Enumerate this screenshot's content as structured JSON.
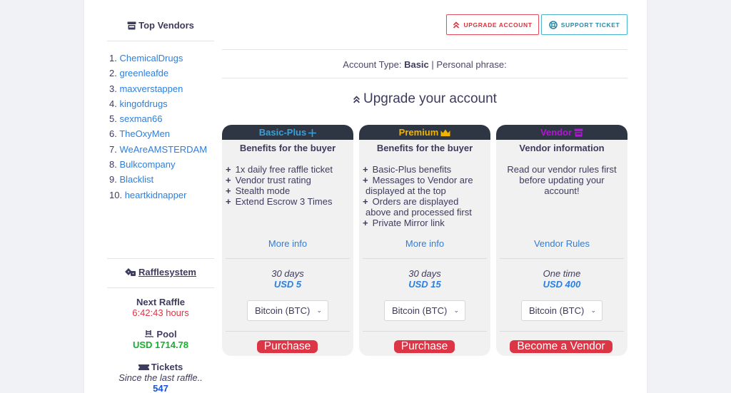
{
  "colors": {
    "link": "#2a7fe0",
    "danger": "#dc3545",
    "success": "#16b02c",
    "card_header": "#2e3644",
    "basic_plus": "#3aa0d8",
    "premium": "#f0b400",
    "vendor": "#b316d6"
  },
  "sidebar": {
    "top_vendors_title": "Top Vendors",
    "top_vendors_icon": "store-icon",
    "vendors": [
      {
        "rank": "1.",
        "name": "ChemicalDrugs"
      },
      {
        "rank": "2.",
        "name": "greenleafde"
      },
      {
        "rank": "3.",
        "name": "maxverstappen"
      },
      {
        "rank": "4.",
        "name": "kingofdrugs"
      },
      {
        "rank": "5.",
        "name": "sexman66"
      },
      {
        "rank": "6.",
        "name": "TheOxyMen"
      },
      {
        "rank": "7.",
        "name": "WeAreAMSTERDAM"
      },
      {
        "rank": "8.",
        "name": "Bulkcompany"
      },
      {
        "rank": "9.",
        "name": "Blacklist"
      },
      {
        "rank": "10.",
        "name": "heartkidnapper"
      }
    ],
    "raffle": {
      "title": "Rafflesystem",
      "title_icon": "dice-icon",
      "next_label": "Next Raffle",
      "next_value": "6:42:43 hours",
      "pool_label": "Pool",
      "pool_icon": "swimming-pool-icon",
      "pool_value": "USD 1714.78",
      "tickets_label": "Tickets",
      "tickets_icon": "ticket-icon",
      "tickets_note": "Since the last raffle..",
      "tickets_value": "547"
    }
  },
  "header": {
    "upgrade_button": "UPGRADE ACCOUNT",
    "support_button": "SUPPORT TICKET"
  },
  "account": {
    "type_label": "Account Type:",
    "type_value": "Basic",
    "separator": "|",
    "phrase_label": "Personal phrase:"
  },
  "upgrade_title": "Upgrade your account",
  "cards": [
    {
      "title": "Basic-Plus",
      "icon": "plus-icon",
      "subtitle": "Benefits for the buyer",
      "benefits": [
        [
          "1x daily free raffle ticket"
        ],
        [
          "Vendor trust rating"
        ],
        [
          "Stealth mode"
        ],
        [
          "Extend Escrow 3 Times"
        ]
      ],
      "link": "More info",
      "duration": "30 days",
      "price": "USD 5",
      "payment_selected": "Bitcoin (BTC)",
      "button": "Purchase"
    },
    {
      "title": "Premium",
      "icon": "crown-icon",
      "subtitle": "Benefits for the buyer",
      "benefits": [
        [
          "Basic-Plus benefits"
        ],
        [
          "Messages to Vendor are",
          "displayed at the top"
        ],
        [
          "Orders are displayed",
          "above and processed first"
        ],
        [
          "Private Mirror link"
        ]
      ],
      "link": "More info",
      "duration": "30 days",
      "price": "USD 15",
      "payment_selected": "Bitcoin (BTC)",
      "button": "Purchase"
    },
    {
      "title": "Vendor",
      "icon": "store-icon",
      "subtitle": "Vendor information",
      "note": "Read our vendor rules first before updating your account!",
      "link": "Vendor Rules",
      "duration": "One time",
      "price": "USD 400",
      "payment_selected": "Bitcoin (BTC)",
      "button": "Become a Vendor"
    }
  ]
}
